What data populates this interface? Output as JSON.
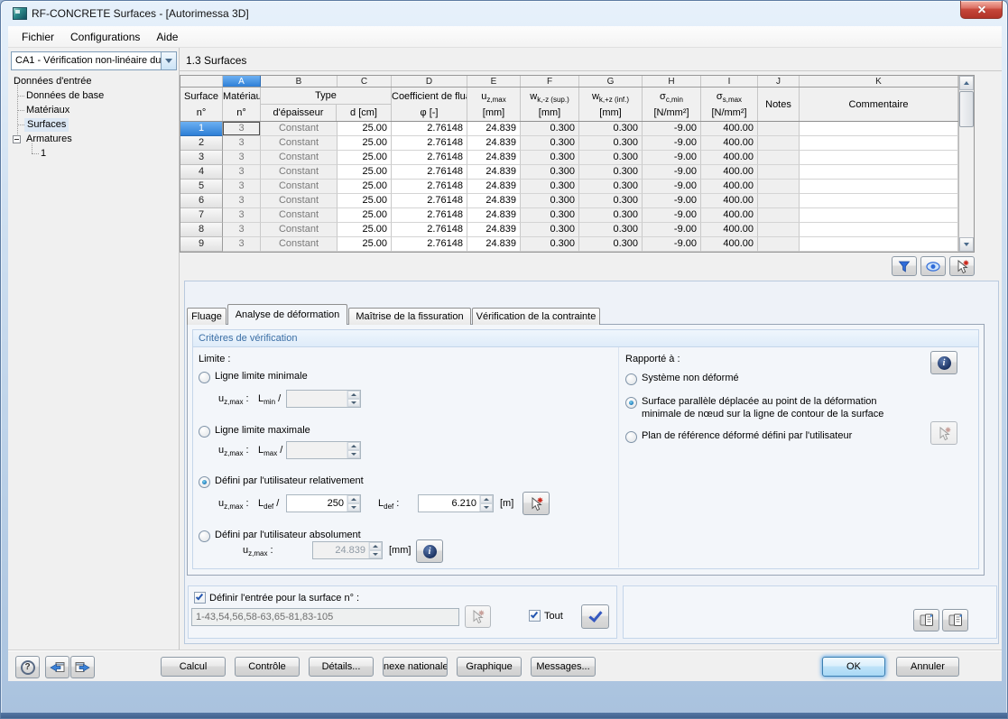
{
  "window": {
    "title": "RF-CONCRETE Surfaces - [Autorimessa 3D]"
  },
  "menu": {
    "items": [
      "Fichier",
      "Configurations",
      "Aide"
    ]
  },
  "sidebar": {
    "case_selector": "CA1 - Vérification non-linéaire du",
    "tree": {
      "root": "Données d'entrée",
      "children": [
        "Données de base",
        "Matériaux",
        "Surfaces",
        "Armatures"
      ],
      "armature_child": "1"
    }
  },
  "main": {
    "section_title": "1.3 Surfaces",
    "table": {
      "letters": [
        "A",
        "B",
        "C",
        "D",
        "E",
        "F",
        "G",
        "H",
        "I",
        "J",
        "K"
      ],
      "head": {
        "surface1": "Surface",
        "surface2": "n°",
        "mat1": "Matériau",
        "mat2": "n°",
        "type": "Type",
        "type_a": "d'épaisseur",
        "type_b": "d [cm]",
        "fluage1": "Coefficient de flua",
        "fluage2": "φ [-]",
        "uz_b": "u",
        "uz_s": "z,max",
        "uz_u": "[mm]",
        "wksup_b": "w",
        "wksup_s": "k,-z (sup.)",
        "wksup_u": "[mm]",
        "wkinf_b": "w",
        "wkinf_s": "k,+z (inf.)",
        "wkinf_u": "[mm]",
        "sc_b": "σ",
        "sc_s": "c,min",
        "sc_u": "[N/mm²]",
        "ss_b": "σ",
        "ss_s": "s,max",
        "ss_u": "[N/mm²]",
        "notes": "Notes",
        "comment": "Commentaire"
      },
      "rows": [
        {
          "n": "1",
          "mat": "3",
          "type": "Constant",
          "d": "25.00",
          "phi": "2.76148",
          "uz": "24.839",
          "wksup": "0.300",
          "wkinf": "0.300",
          "sc": "-9.00",
          "ss": "400.00",
          "notes": "",
          "comment": ""
        },
        {
          "n": "2",
          "mat": "3",
          "type": "Constant",
          "d": "25.00",
          "phi": "2.76148",
          "uz": "24.839",
          "wksup": "0.300",
          "wkinf": "0.300",
          "sc": "-9.00",
          "ss": "400.00",
          "notes": "",
          "comment": ""
        },
        {
          "n": "3",
          "mat": "3",
          "type": "Constant",
          "d": "25.00",
          "phi": "2.76148",
          "uz": "24.839",
          "wksup": "0.300",
          "wkinf": "0.300",
          "sc": "-9.00",
          "ss": "400.00",
          "notes": "",
          "comment": ""
        },
        {
          "n": "4",
          "mat": "3",
          "type": "Constant",
          "d": "25.00",
          "phi": "2.76148",
          "uz": "24.839",
          "wksup": "0.300",
          "wkinf": "0.300",
          "sc": "-9.00",
          "ss": "400.00",
          "notes": "",
          "comment": ""
        },
        {
          "n": "5",
          "mat": "3",
          "type": "Constant",
          "d": "25.00",
          "phi": "2.76148",
          "uz": "24.839",
          "wksup": "0.300",
          "wkinf": "0.300",
          "sc": "-9.00",
          "ss": "400.00",
          "notes": "",
          "comment": ""
        },
        {
          "n": "6",
          "mat": "3",
          "type": "Constant",
          "d": "25.00",
          "phi": "2.76148",
          "uz": "24.839",
          "wksup": "0.300",
          "wkinf": "0.300",
          "sc": "-9.00",
          "ss": "400.00",
          "notes": "",
          "comment": ""
        },
        {
          "n": "7",
          "mat": "3",
          "type": "Constant",
          "d": "25.00",
          "phi": "2.76148",
          "uz": "24.839",
          "wksup": "0.300",
          "wkinf": "0.300",
          "sc": "-9.00",
          "ss": "400.00",
          "notes": "",
          "comment": ""
        },
        {
          "n": "8",
          "mat": "3",
          "type": "Constant",
          "d": "25.00",
          "phi": "2.76148",
          "uz": "24.839",
          "wksup": "0.300",
          "wkinf": "0.300",
          "sc": "-9.00",
          "ss": "400.00",
          "notes": "",
          "comment": ""
        },
        {
          "n": "9",
          "mat": "3",
          "type": "Constant",
          "d": "25.00",
          "phi": "2.76148",
          "uz": "24.839",
          "wksup": "0.300",
          "wkinf": "0.300",
          "sc": "-9.00",
          "ss": "400.00",
          "notes": "",
          "comment": ""
        }
      ]
    },
    "tabs": [
      "Fluage",
      "Analyse de déformation",
      "Maîtrise de la fissuration",
      "Vérification de la contrainte"
    ],
    "criteria": {
      "title": "Critères de vérification",
      "limite_label": "Limite :",
      "opt_min": {
        "label": "Ligne limite minimale",
        "u_b": "u",
        "u_s": "z,max",
        "u_t": " :",
        "l_b": "L",
        "l_s": "min",
        "l_t": " /",
        "value": ""
      },
      "opt_max": {
        "label": "Ligne limite maximale",
        "u_b": "u",
        "u_s": "z,max",
        "u_t": " :",
        "l_b": "L",
        "l_s": "max",
        "l_t": " /",
        "value": ""
      },
      "opt_rel": {
        "label": "Défini par l'utilisateur relativement",
        "u_b": "u",
        "u_s": "z,max",
        "u_t": " :",
        "l_b": "L",
        "l_s": "def",
        "l_t": " /",
        "value": "250",
        "l2_b": "L",
        "l2_s": "def",
        "l2_t": " :",
        "value2": "6.210",
        "unit": "[m]"
      },
      "opt_abs": {
        "label": "Défini par l'utilisateur absolument",
        "u_b": "u",
        "u_s": "z,max",
        "u_t": " :",
        "value": "24.839",
        "unit": "[mm]"
      },
      "rapporte_label": "Rapporté à :",
      "opt_sys": "Système non déformé",
      "opt_surf_1": "Surface parallèle déplacée au point de la déformation",
      "opt_surf_2": "minimale de nœud sur la ligne de contour de la surface",
      "opt_plan": "Plan de référence déformé défini par l'utilisateur"
    },
    "apply": {
      "checkbox_label": "Définir l'entrée pour la surface n° :",
      "value": "1-43,54,56,58-63,65-81,83-105",
      "tout_label": "Tout"
    }
  },
  "footer": {
    "buttons": [
      "Calcul",
      "Contrôle",
      "Détails...",
      "nexe nationale",
      "Graphique",
      "Messages..."
    ],
    "ok": "OK",
    "cancel": "Annuler"
  }
}
